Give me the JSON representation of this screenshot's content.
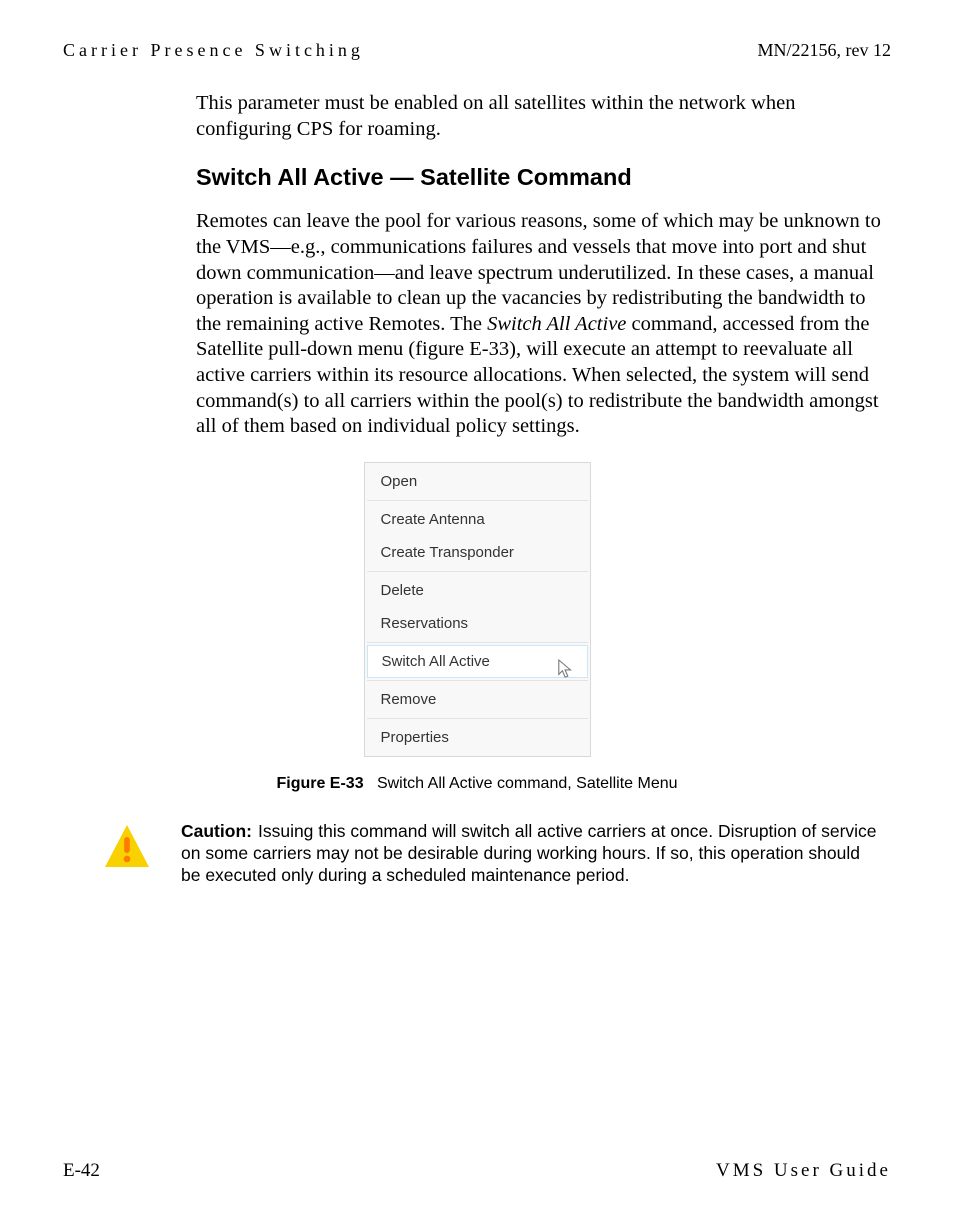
{
  "header": {
    "left": "Carrier Presence Switching",
    "right": "MN/22156, rev 12"
  },
  "intro_para": "This parameter must be enabled on all satellites within the network when configuring CPS for roaming.",
  "section_heading": "Switch All Active — Satellite Command",
  "main_para_before_italic": "Remotes can leave the pool for various reasons, some of which may be unknown to the VMS—e.g., communications failures and vessels that move into port and shut down communication—and leave spectrum underutilized. In these cases, a manual operation is available to clean up the vacancies by redistributing the bandwidth to the remaining active Remotes. The ",
  "main_para_italic": "Switch All Active",
  "main_para_after_italic": " command, accessed from the Satellite pull-down menu (figure E-33), will execute an attempt to reevaluate all active carriers within its resource allocations. When selected, the system will send command(s) to all carriers within the pool(s) to redistribute the bandwidth amongst all of them based on individual policy settings.",
  "menu": {
    "open": "Open",
    "create_antenna": "Create Antenna",
    "create_transponder": "Create Transponder",
    "delete": "Delete",
    "reservations": "Reservations",
    "switch_all_active": "Switch All Active",
    "remove": "Remove",
    "properties": "Properties"
  },
  "figure": {
    "label": "Figure E-33",
    "caption": "Switch All Active command, Satellite Menu"
  },
  "caution": {
    "label": "Caution:",
    "text": "Issuing this command will switch all active carriers at once. Disruption of service on some carriers may not be desirable during working hours. If so, this operation should be executed only during a scheduled maintenance period."
  },
  "footer": {
    "left": "E-42",
    "right": "VMS User Guide"
  }
}
